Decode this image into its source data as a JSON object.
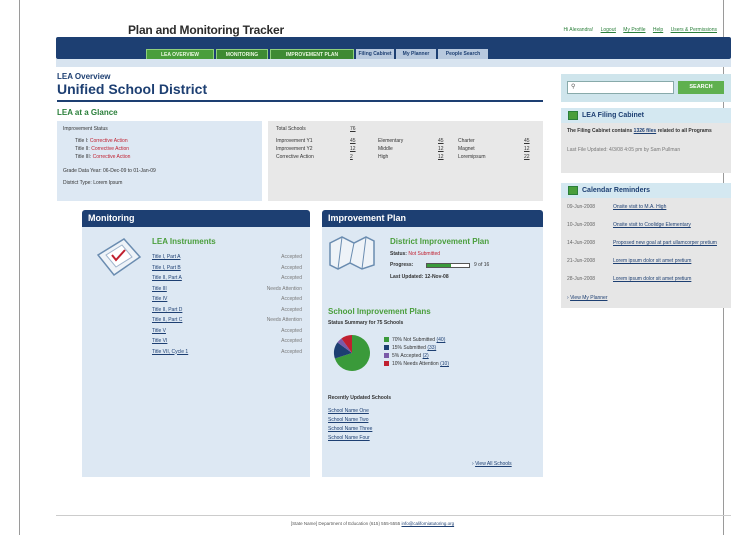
{
  "app": {
    "title": "Plan and Monitoring Tracker"
  },
  "top_links": {
    "greeting": "Hi Alexandra!",
    "logout": "Logout",
    "profile": "My Profile",
    "help": "Help",
    "users": "Users & Permissions"
  },
  "nav": {
    "tabs": [
      "LEA OVERVIEW",
      "MONITORING",
      "IMPROVEMENT PLAN",
      "Filing Cabinet",
      "My Planner",
      "People Search"
    ]
  },
  "page": {
    "breadcrumb": "LEA Overview",
    "title": "Unified School District"
  },
  "glance": {
    "heading": "LEA at a Glance",
    "improvement_status_label": "Improvement Status",
    "title_lines": [
      {
        "label": "Title I:",
        "value": "Corrective Action"
      },
      {
        "label": "Title II:",
        "value": "Corrective Action"
      },
      {
        "label": "Title III:",
        "value": "Corrective Action"
      }
    ],
    "grade_span": "Grade Data Year: 06-Dec-09 to 01-Jan-09",
    "district_type": "District Type: Lorem Ipsum",
    "total_label": "Total Schools",
    "total_value": "76",
    "stats": [
      {
        "label": "Improvement Y1",
        "value": "45"
      },
      {
        "label": "Improvement Y2",
        "value": "12"
      },
      {
        "label": "Corrective Action",
        "value": "2"
      }
    ],
    "levels": [
      {
        "label": "Elementary",
        "value": "45"
      },
      {
        "label": "Middle",
        "value": "12"
      },
      {
        "label": "High",
        "value": "12"
      }
    ],
    "types": [
      {
        "label": "Charter",
        "value": "45"
      },
      {
        "label": "Magnet",
        "value": "12"
      },
      {
        "label": "Loremipsum",
        "value": "22"
      }
    ]
  },
  "monitoring": {
    "heading": "Monitoring",
    "subheading": "LEA Instruments",
    "instruments": [
      {
        "name": "Title I, Part A",
        "status": "Accepted"
      },
      {
        "name": "Title I, Part B",
        "status": "Accepted"
      },
      {
        "name": "Title II, Part A",
        "status": "Accepted"
      },
      {
        "name": "Title III",
        "status": "Needs Attention"
      },
      {
        "name": "Title IV",
        "status": "Accepted"
      },
      {
        "name": "Title II, Part D",
        "status": "Accepted"
      },
      {
        "name": "Title II, Part C",
        "status": "Needs Attention"
      },
      {
        "name": "Title V",
        "status": "Accepted"
      },
      {
        "name": "Title VI",
        "status": "Accepted"
      },
      {
        "name": "Title VII, Cycle 1",
        "status": "Accepted"
      }
    ]
  },
  "improvement": {
    "heading": "Improvement Plan",
    "district_plan": "District Improvement Plan",
    "status_label": "Status:",
    "status_value": "Not Submitted",
    "progress_label": "Progress:",
    "progress_text": "9 of 16",
    "progress_fraction": 0.5625,
    "updated": "Last Updated: 12-Nov-08",
    "school_plans": "School Improvement Plans",
    "summary": "Status Summary for 75 Schools",
    "legend": [
      {
        "text": "70% Not Submitted",
        "count": "(40)",
        "color": "#3a9a3a"
      },
      {
        "text": "15% Submitted",
        "count": "(33)",
        "color": "#1d3f72"
      },
      {
        "text": "5% Accepted",
        "count": "(2)",
        "color": "#7a5aa8"
      },
      {
        "text": "10% Needs Attention",
        "count": "(10)",
        "color": "#c02030"
      }
    ],
    "recent_heading": "Recently Updated Schools",
    "recent": [
      "School Name One",
      "School Name Two",
      "School Name Three",
      "School Name Four"
    ],
    "view_all": "View All Schools"
  },
  "sidebar": {
    "search_button": "SEARCH",
    "filing_title": "LEA Filing Cabinet",
    "filing_text_pre": "The Filing Cabinet contains",
    "filing_count": "1326 files",
    "filing_text_post": "related to all Programs",
    "filing_updated": "Last File Updated: 4/3/08 4:05 pm by Sam Pullman",
    "calendar_title": "Calendar Reminders",
    "reminders": [
      {
        "date": "09-Jun-2008",
        "text": "Onsite visit to M.A. High"
      },
      {
        "date": "10-Jun-2008",
        "text": "Onsite visit to Coolidge Elementary"
      },
      {
        "date": "14-Jun-2008",
        "text": "Proposed new goal at part ullamcorper pretium"
      },
      {
        "date": "21-Jun-2008",
        "text": "Lorem ipsum dolor sit amet pretium"
      },
      {
        "date": "28-Jun-2008",
        "text": "Lorem ipsum dolor sit amet pretium"
      }
    ],
    "planner_link": "View My Planner"
  },
  "footer": {
    "text": "[State Name] Department of Education (615) 555-5555",
    "email": "info@californiatutoring.org"
  },
  "pie": [
    0.7,
    0.15,
    0.05,
    0.1
  ]
}
